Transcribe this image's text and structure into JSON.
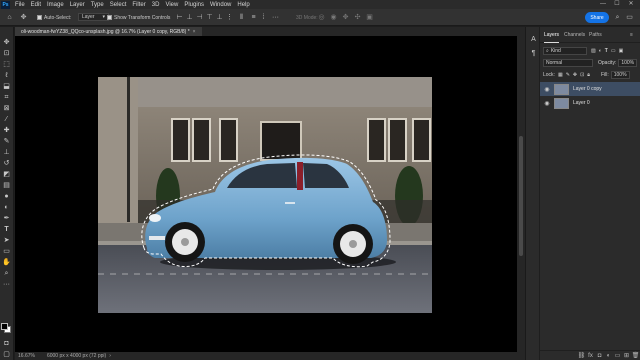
{
  "app": {
    "logo": "Ps"
  },
  "menu": [
    "File",
    "Edit",
    "Image",
    "Layer",
    "Type",
    "Select",
    "Filter",
    "3D",
    "View",
    "Plugins",
    "Window",
    "Help"
  ],
  "window_controls": [
    "—",
    "☐",
    "✕"
  ],
  "options": {
    "auto_select_label": "Auto-Select:",
    "auto_select_value": "Layer",
    "show_transform_label": "Show Transform Controls",
    "mode_3d_label": "3D Mode:",
    "more": "···",
    "share_label": "Share"
  },
  "document": {
    "tab_title": "oli-woodman-fwYZ38_QQco-unsplash.jpg @ 16.7% (Layer 0 copy, RGB/8) *",
    "close": "×"
  },
  "status": {
    "zoom": "16.67%",
    "doc_size": "6000 px x 4000 px (72 ppi)",
    "arrow": "›"
  },
  "tools": [
    "move-tool-icon",
    "artboard-tool-icon",
    "marquee-tool-icon",
    "lasso-tool-icon",
    "object-select-tool-icon",
    "crop-tool-icon",
    "frame-tool-icon",
    "eyedropper-tool-icon",
    "spot-healing-tool-icon",
    "brush-tool-icon",
    "clone-stamp-tool-icon",
    "history-brush-tool-icon",
    "eraser-tool-icon",
    "gradient-tool-icon",
    "blur-tool-icon",
    "dodge-tool-icon",
    "pen-tool-icon",
    "type-tool-icon",
    "path-select-tool-icon",
    "rectangle-tool-icon",
    "hand-tool-icon",
    "zoom-tool-icon",
    "more-tools-icon"
  ],
  "panel": {
    "tabs": [
      "Layers",
      "Channels",
      "Paths"
    ],
    "filter_kind": "Kind",
    "blend_mode": "Normal",
    "opacity_label": "Opacity:",
    "opacity_value": "100%",
    "lock_label": "Lock:",
    "fill_label": "Fill:",
    "fill_value": "100%",
    "layers": [
      {
        "name": "Layer 0 copy",
        "selected": true
      },
      {
        "name": "Layer 0",
        "selected": false
      }
    ]
  },
  "colors": {
    "accent": "#1473e6",
    "selected_layer": "#3d4d63",
    "car_blue": "#7fb3d8"
  }
}
